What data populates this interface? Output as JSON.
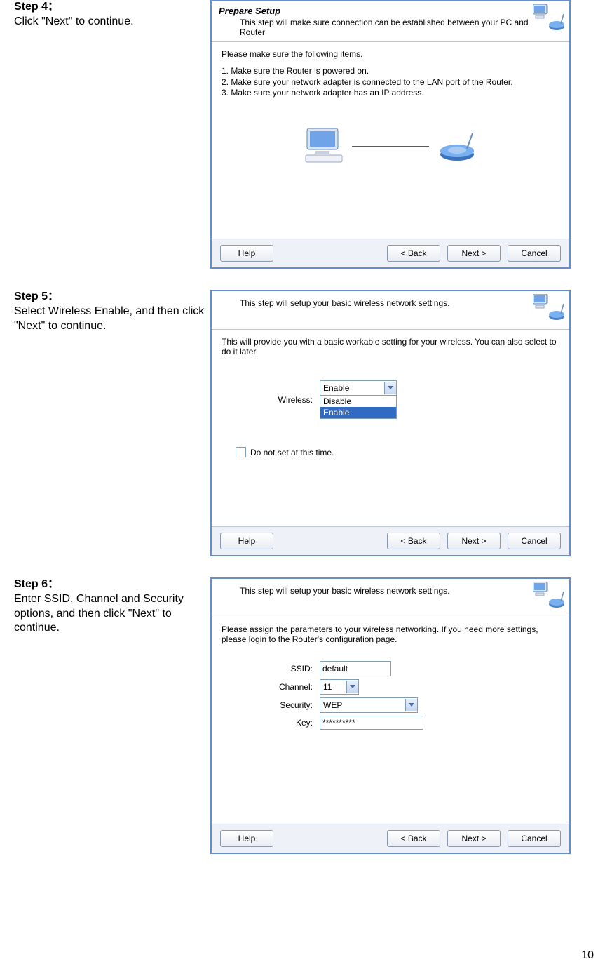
{
  "page_number": "10",
  "steps": [
    {
      "title": "Step 4：",
      "desc": "Click \"Next\" to continue."
    },
    {
      "title": "Step 5：",
      "desc": "Select Wireless Enable, and then click \"Next\" to continue."
    },
    {
      "title": "Step 6：",
      "desc": "Enter SSID, Channel and Security options, and then click \"Next\" to continue."
    }
  ],
  "dialog4": {
    "title": "Prepare Setup",
    "subtitle": "This step will make sure connection can be established between your PC and Router",
    "pleasemake": "Please make sure the following items.",
    "items": [
      "1. Make sure the Router is powered on.",
      "2. Make sure your network adapter is connected to the LAN port of the Router.",
      "3. Make sure your network adapter has an IP address."
    ],
    "btn_help": "Help",
    "btn_back": "< Back",
    "btn_next": "Next >",
    "btn_cancel": "Cancel"
  },
  "dialog5": {
    "subtitle": "This step will setup your basic wireless network settings.",
    "info": "This will provide you with a basic workable setting for your wireless. You can also select to do it later.",
    "wireless_label": "Wireless:",
    "dd_selected": "Enable",
    "dd_opts": [
      "Disable",
      "Enable"
    ],
    "checkbox_label": "Do not set at this time.",
    "btn_help": "Help",
    "btn_back": "< Back",
    "btn_next": "Next >",
    "btn_cancel": "Cancel"
  },
  "dialog6": {
    "subtitle": "This step will setup your basic wireless network settings.",
    "info": "Please assign the parameters to your wireless networking. If you need more settings, please login to the Router's configuration page.",
    "ssid_label": "SSID:",
    "ssid_value": "default",
    "channel_label": "Channel:",
    "channel_value": "11",
    "security_label": "Security:",
    "security_value": "WEP",
    "key_label": "Key:",
    "key_value": "**********",
    "btn_help": "Help",
    "btn_back": "< Back",
    "btn_next": "Next >",
    "btn_cancel": "Cancel"
  }
}
